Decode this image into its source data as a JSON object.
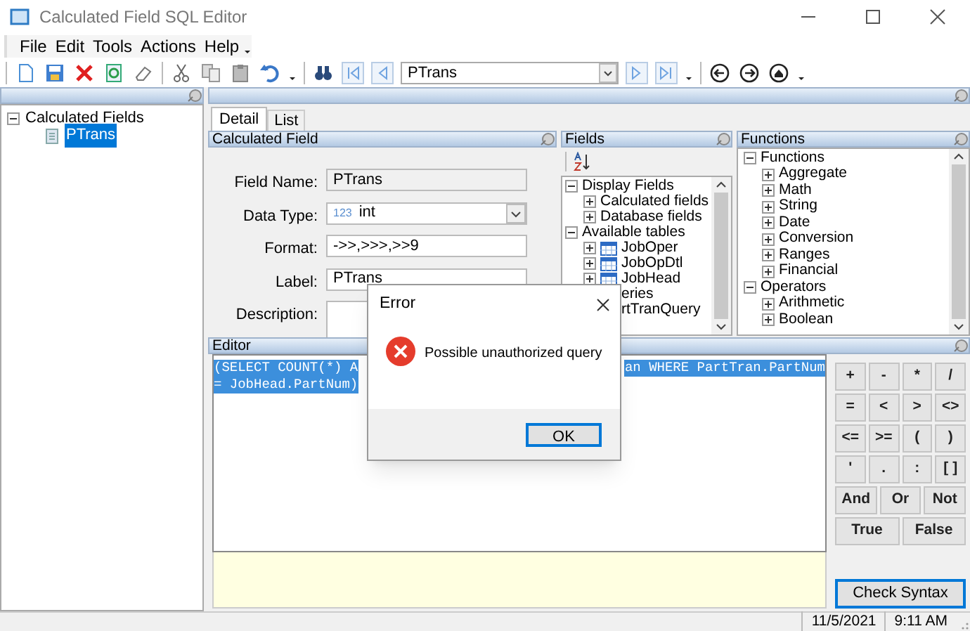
{
  "window": {
    "title": "Calculated Field SQL Editor"
  },
  "menu": [
    {
      "label": "File"
    },
    {
      "label": "Edit"
    },
    {
      "label": "Tools"
    },
    {
      "label": "Actions"
    },
    {
      "label": "Help"
    }
  ],
  "toolbar": {
    "record_combo": {
      "value": "PTrans"
    }
  },
  "tree_panel": {
    "items": [
      {
        "label": "Calculated Fields",
        "selected": false,
        "expanded": true,
        "children": [
          {
            "label": "PTrans",
            "selected": true
          }
        ]
      }
    ]
  },
  "tabs": [
    {
      "label": "Detail",
      "selected": true
    },
    {
      "label": "List",
      "selected": false
    }
  ],
  "calculated_field": {
    "title": "Calculated Field",
    "rows": [
      {
        "kind": "readonly",
        "label": "Field Name:",
        "value": "PTrans"
      },
      {
        "kind": "dropdown",
        "label": "Data Type:",
        "prefix": "123",
        "value": "int"
      },
      {
        "kind": "text",
        "label": "Format:",
        "value": "->>,>>>,>>9"
      },
      {
        "kind": "text",
        "label": "Label:",
        "value": "PTrans"
      },
      {
        "kind": "textarea",
        "label": "Description:"
      }
    ]
  },
  "fields": {
    "title": "Fields",
    "items": [
      {
        "kind": "group",
        "label": "Display Fields",
        "expanded": true,
        "children": [
          {
            "kind": "group",
            "label": "Calculated fields",
            "expanded": false
          },
          {
            "kind": "group",
            "label": "Database fields",
            "expanded": false
          }
        ]
      },
      {
        "kind": "group",
        "label": "Available tables",
        "expanded": true,
        "children": [
          {
            "kind": "table",
            "label": "JobOper",
            "expanded": false
          },
          {
            "kind": "table",
            "label": "JobOpDtl",
            "expanded": false
          },
          {
            "kind": "table",
            "label": "JobHead",
            "expanded": false
          }
        ]
      },
      {
        "kind": "cut",
        "label": "eries"
      },
      {
        "kind": "cut",
        "label": "rtTranQuery"
      }
    ]
  },
  "functions": {
    "title": "Functions",
    "items": [
      {
        "label": "Functions",
        "expanded": true,
        "children": [
          {
            "label": "Aggregate",
            "expanded": false
          },
          {
            "label": "Math",
            "expanded": false
          },
          {
            "label": "String",
            "expanded": false
          },
          {
            "label": "Date",
            "expanded": false
          },
          {
            "label": "Conversion",
            "expanded": false
          },
          {
            "label": "Ranges",
            "expanded": false
          },
          {
            "label": "Financial",
            "expanded": false
          }
        ]
      },
      {
        "label": "Operators",
        "expanded": true,
        "children": [
          {
            "label": "Arithmetic",
            "expanded": false
          },
          {
            "label": "Boolean",
            "expanded": false
          }
        ]
      }
    ]
  },
  "editor": {
    "title": "Editor",
    "lines": [
      {
        "text_start": "(SELECT COUNT(*) A",
        "text_end": "an WHERE PartTran.PartNum"
      },
      {
        "text_start": "= JobHead.PartNum)"
      }
    ],
    "operator_rows": [
      [
        "+",
        "-",
        "*",
        "/"
      ],
      [
        "=",
        "<",
        ">",
        "<>"
      ],
      [
        "<=",
        ">=",
        "(",
        ")"
      ],
      [
        "'",
        ".",
        ":",
        "[ ]"
      ],
      [
        "And",
        "Or",
        "Not"
      ],
      [
        "True",
        "False"
      ]
    ],
    "check_syntax": "Check Syntax"
  },
  "status_bar": {
    "date": "11/5/2021",
    "time": "9:11 AM"
  },
  "dialog": {
    "title": "Error",
    "message": "Possible unauthorized query",
    "button": "OK"
  }
}
